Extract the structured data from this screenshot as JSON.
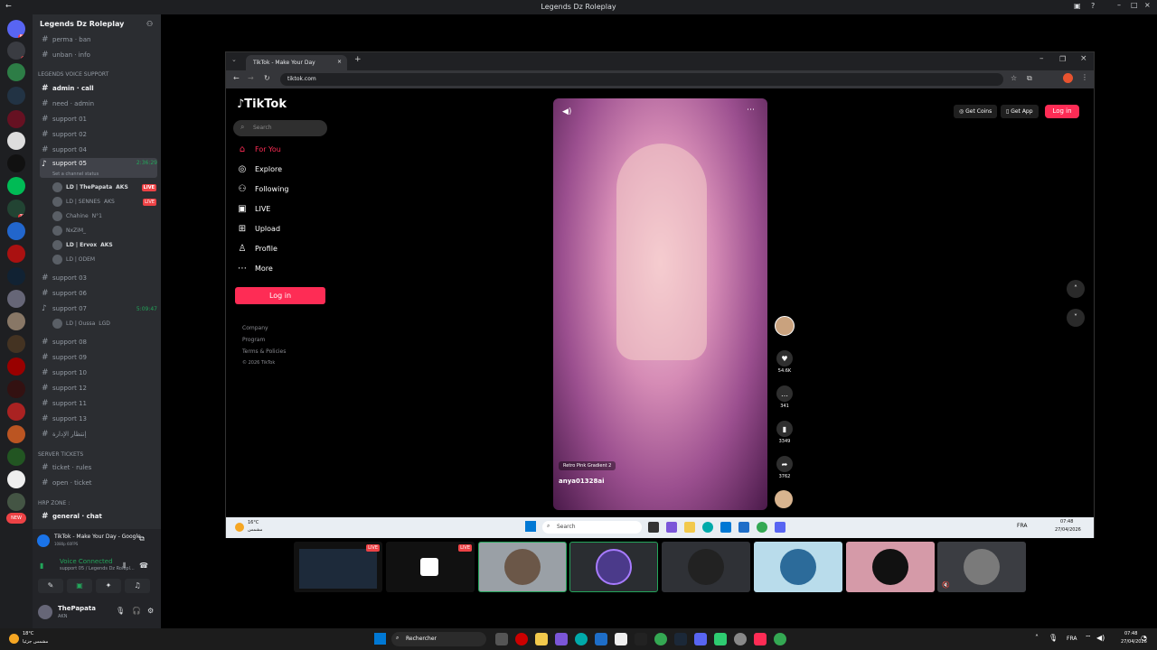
{
  "window": {
    "title": "Legends Dz Roleplay"
  },
  "rail": {
    "badges": [
      "84",
      "1",
      "22",
      "NEW"
    ]
  },
  "server": {
    "name": "Legends Dz Roleplay"
  },
  "channels_top": [
    {
      "label": "perma · ban"
    },
    {
      "label": "unban · info"
    }
  ],
  "category_voice": "LEGENDS VOICE SUPPORT",
  "voice_channels_a": [
    {
      "label": "admin · call",
      "bold": true
    },
    {
      "label": "need · admin"
    },
    {
      "label": "support 01"
    },
    {
      "label": "support 02"
    },
    {
      "label": "support 04"
    }
  ],
  "active_channel": {
    "label": "support 05",
    "timer": "2:36:29",
    "status": "Set a channel status"
  },
  "voice_users": [
    {
      "name": "LD | ThePapata",
      "tag": "AKS",
      "live": "LIVE"
    },
    {
      "name": "LD | SENNES",
      "tag": "AKS",
      "live": "LIVE"
    },
    {
      "name": "Chahine",
      "tag": "N°1",
      "live": ""
    },
    {
      "name": "NxZiM_",
      "tag": "",
      "live": ""
    },
    {
      "name": "LD | Ervox",
      "tag": "AKS",
      "live": ""
    },
    {
      "name": "LD | ODEM",
      "tag": "",
      "live": ""
    }
  ],
  "voice_channels_b": [
    {
      "label": "support 03"
    },
    {
      "label": "support 06"
    },
    {
      "label": "support 07",
      "timer": "5:09:47"
    }
  ],
  "support07_user": {
    "name": "LD | Oussa",
    "tag": "LGD"
  },
  "voice_channels_c": [
    {
      "label": "support 08"
    },
    {
      "label": "support 09"
    },
    {
      "label": "support 10"
    },
    {
      "label": "support 12"
    },
    {
      "label": "support 11"
    },
    {
      "label": "support 13"
    },
    {
      "label": "إنتظار الإدارة"
    }
  ],
  "category_tickets": "SERVER TICKETS",
  "ticket_channels": [
    {
      "label": "ticket · rules"
    },
    {
      "label": "open · ticket"
    }
  ],
  "category_rp": "HRP Zone :",
  "rp_channels": [
    {
      "label": "general · chat"
    }
  ],
  "activity": {
    "title": "TikTok - Make Your Day - Google ...",
    "sub": "1080p 60FPS"
  },
  "voice_connected": {
    "label": "Voice Connected",
    "sub": "support 05 / Legends Dz Rolepl..."
  },
  "user": {
    "name": "ThePapata",
    "status": "AKN"
  },
  "browser": {
    "tab_title": "TikTok - Make Your Day",
    "url": "tiktok.com"
  },
  "tiktok": {
    "logo": "TikTok",
    "search_placeholder": "Search",
    "nav": [
      "For You",
      "Explore",
      "Following",
      "LIVE",
      "Upload",
      "Profile",
      "More"
    ],
    "login": "Log in",
    "footer": [
      "Company",
      "Program",
      "Terms & Policies",
      "© 2026 TikTok"
    ],
    "top_right": {
      "coins": "Get Coins",
      "app": "Get App",
      "login": "Log in"
    },
    "video": {
      "effect": "Retro Pink Gradient 2",
      "author": "anya01328ai"
    },
    "actions": {
      "likes": "54.6K",
      "comments": "341",
      "saves": "3349",
      "shares": "3762"
    }
  },
  "inner_taskbar": {
    "weather_temp": "16°C",
    "weather_desc": "مشمس",
    "search": "Search",
    "lang": "FRA",
    "time": "07:48",
    "date": "27/04/2026"
  },
  "grid": {
    "live1": "LIVE",
    "live2": "LIVE"
  },
  "taskbar": {
    "weather_temp": "18°C",
    "weather_desc": "مشمس جزئيا",
    "search": "Rechercher",
    "lang": "FRA",
    "time": "07:48",
    "date": "27/04/2026"
  },
  "colors": {
    "accent": "#fe2c55",
    "discord_green": "#23a55a",
    "live_red": "#ed4245"
  }
}
